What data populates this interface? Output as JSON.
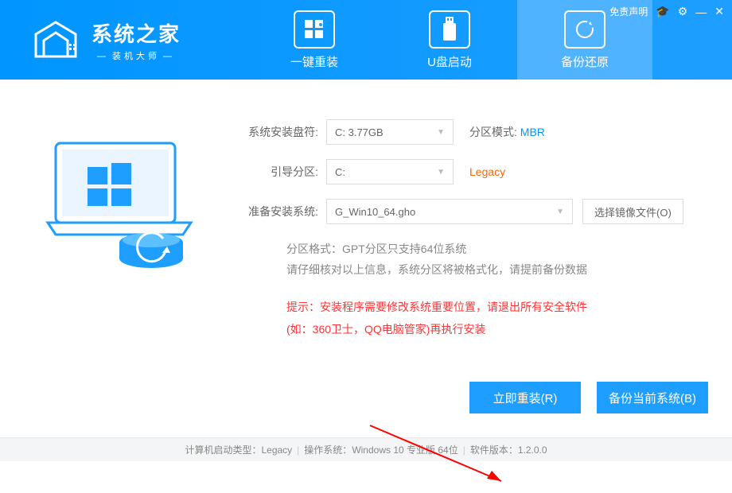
{
  "header": {
    "logo_title": "系统之家",
    "logo_sub": "装机大师",
    "disclaimer": "免责声明"
  },
  "tabs": [
    {
      "label": "一键重装"
    },
    {
      "label": "U盘启动"
    },
    {
      "label": "备份还原"
    }
  ],
  "form": {
    "install_drive_label": "系统安装盘符:",
    "install_drive_value": "C: 3.77GB",
    "partition_mode_label": "分区模式:",
    "partition_mode_value": "MBR",
    "boot_partition_label": "引导分区:",
    "boot_partition_value": "C:",
    "boot_mode": "Legacy",
    "prepare_label": "准备安装系统:",
    "prepare_value": "G_Win10_64.gho",
    "choose_image_btn": "选择镜像文件(O)"
  },
  "info": {
    "line1": "分区格式：GPT分区只支持64位系统",
    "line2": "请仔细核对以上信息，系统分区将被格式化，请提前备份数据"
  },
  "warning": {
    "line1": "提示：安装程序需要修改系统重要位置，请退出所有安全软件",
    "line2": "(如：360卫士，QQ电脑管家)再执行安装"
  },
  "buttons": {
    "reinstall": "立即重装(R)",
    "backup": "备份当前系统(B)"
  },
  "status": {
    "boot_type_label": "计算机启动类型：",
    "boot_type_value": "Legacy",
    "os_label": "操作系统：",
    "os_value": "Windows 10 专业版 64位",
    "version_label": "软件版本：",
    "version_value": "1.2.0.0"
  }
}
